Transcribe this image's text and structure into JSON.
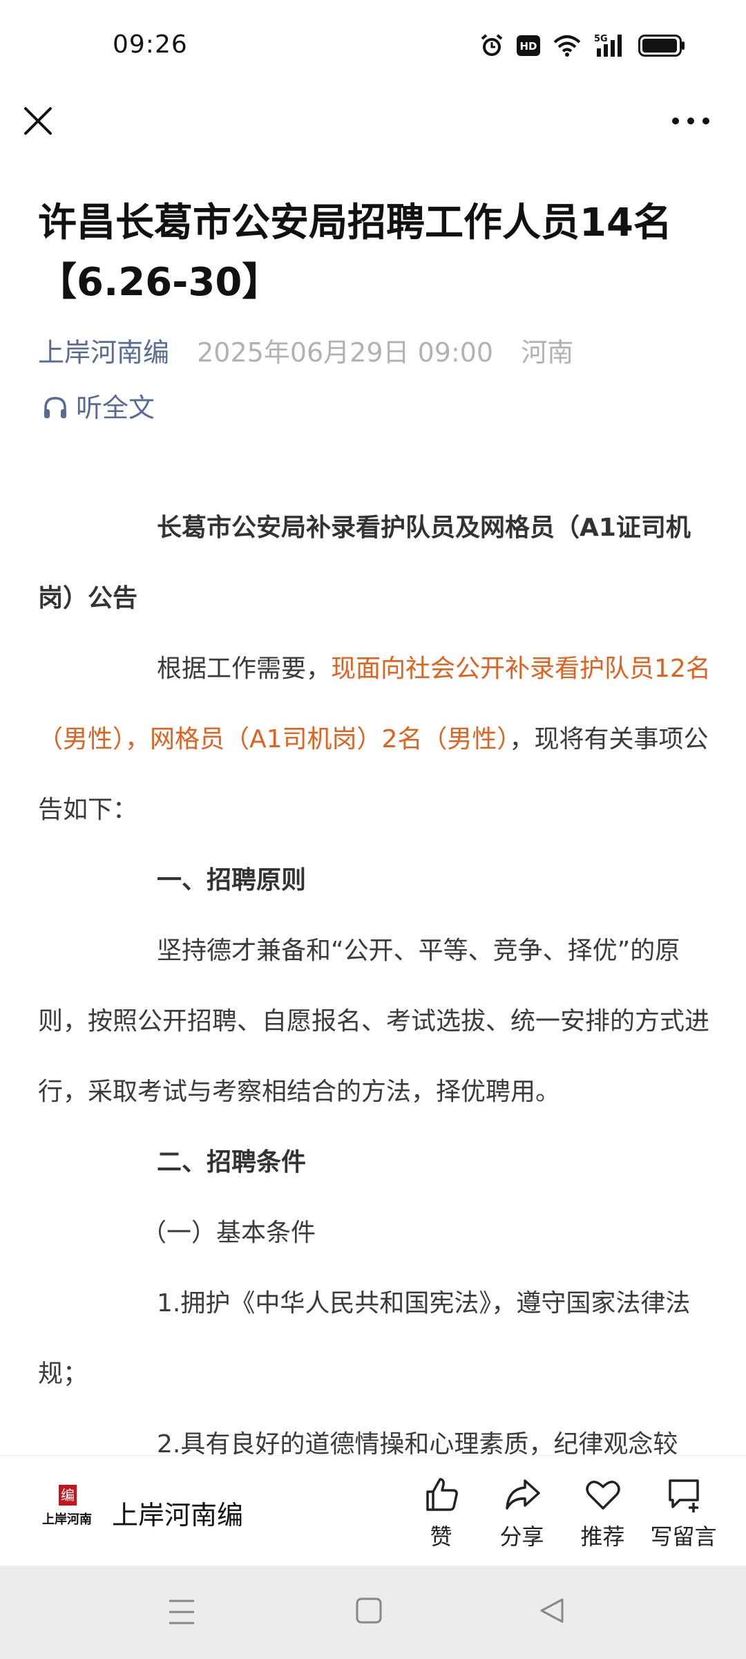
{
  "status_bar": {
    "time": "09:26",
    "icons": [
      "alarm-icon",
      "hd-icon",
      "wifi-icon",
      "5g-signal-icon",
      "battery-icon"
    ],
    "hd_label": "HD",
    "network_label": "5G"
  },
  "nav": {
    "close_icon": "close-icon",
    "more_icon": "more-icon"
  },
  "article": {
    "title": "许昌长葛市公安局招聘工作人员14名【6.26-30】",
    "author": "上岸河南编",
    "date": "2025年06月29日 09:00",
    "region": "河南",
    "listen_label": "听全文",
    "heading": "长葛市公安局补录看护队员及网格员（A1证司机岗）公告",
    "intro_prefix": "根据工作需要，",
    "intro_highlight": "现面向社会公开补录看护队员12名（男性），网格员（A1司机岗）2名（男性）",
    "intro_suffix": "，现将有关事项公告如下：",
    "section1_title": "一、招聘原则",
    "section1_text": "坚持德才兼备和“公开、平等、竞争、择优”的原则，按照公开招聘、自愿报名、考试选拔、统一安排的方式进行，采取考试与考察相结合的方法，择优聘用。",
    "section2_title": "二、招聘条件",
    "subsection1_title": "（一）基本条件",
    "item1": "1.拥护《中华人民共和国宪法》，遵守国家法律法规；",
    "item2": "2.具有良好的道德情操和心理素质，纪律观念较"
  },
  "toolbar": {
    "logo_seal": "编",
    "logo_text": "上岸河南",
    "account_name": "上岸河南编",
    "like_label": "赞",
    "share_label": "分享",
    "recommend_label": "推荐",
    "comment_label": "写留言"
  },
  "colors": {
    "link": "#576b95",
    "highlight": "#e0621f",
    "meta_gray": "#b2b2b2",
    "seal_red": "#c4161c"
  }
}
